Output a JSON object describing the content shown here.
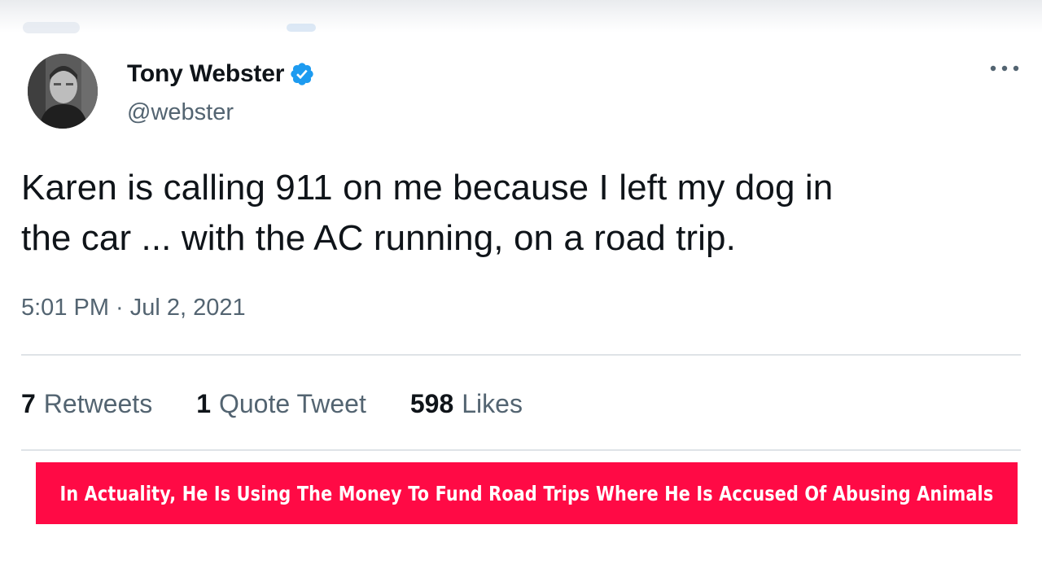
{
  "tweet": {
    "display_name": "Tony Webster",
    "handle": "@webster",
    "verified": true,
    "text_line_1": "Karen is calling 911 on me because I left my dog in",
    "text_line_2": "the car ... with the AC running, on a road trip.",
    "timestamp": "5:01 PM · Jul 2, 2021",
    "stats": {
      "retweets_count": "7",
      "retweets_label": "Retweets",
      "quotes_count": "1",
      "quotes_label": "Quote Tweet",
      "likes_count": "598",
      "likes_label": "Likes"
    },
    "icons": {
      "avatar": "avatar-photo",
      "verified": "verified-badge-icon",
      "more": "more-options-icon"
    },
    "colors": {
      "verified_blue": "#1d9bf0",
      "text_primary": "#0f1419",
      "text_secondary": "#536471"
    }
  },
  "caption": {
    "text": "In Actuality, He Is Using The Money To Fund Road Trips Where He Is Accused Of Abusing Animals",
    "background": "#ff0a45",
    "color": "#ffffff"
  }
}
